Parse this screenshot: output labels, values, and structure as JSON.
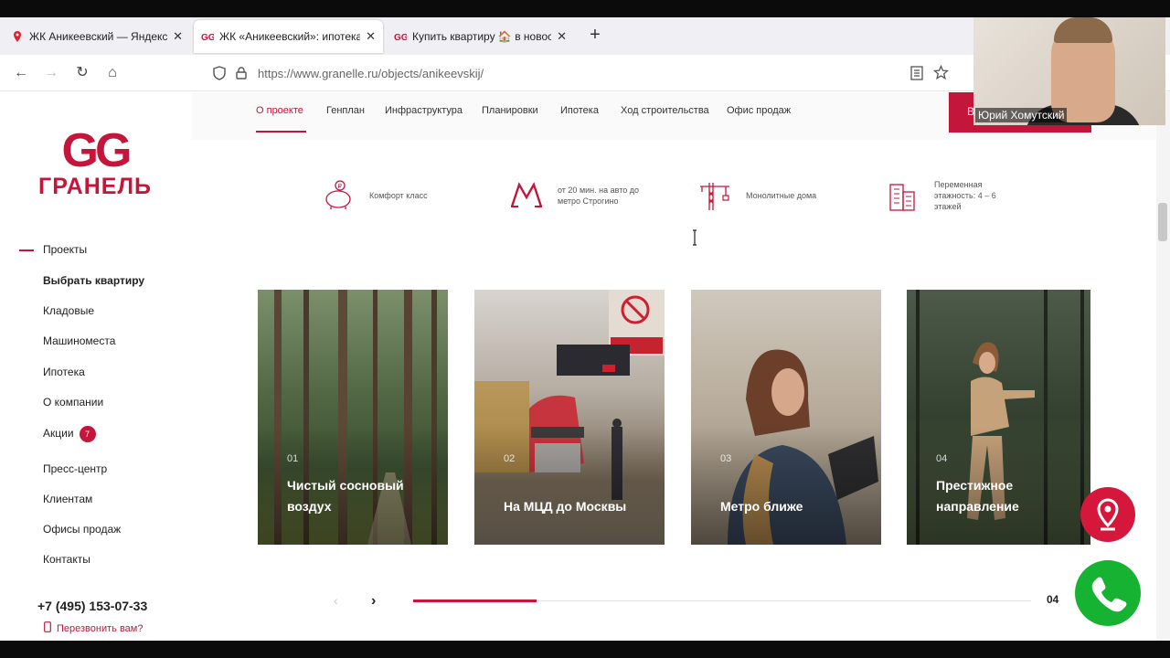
{
  "browser": {
    "tabs": [
      {
        "label": "ЖК Аникеевский — Яндекс.Карты",
        "active": false,
        "favicon": "map-pin-icon"
      },
      {
        "label": "ЖК «Аникеевский»: ипотека и",
        "active": true,
        "favicon": "granel-gg-icon"
      },
      {
        "label": "Купить квартиру 🏠 в новостройке",
        "active": false,
        "favicon": "granel-gg-icon"
      }
    ],
    "url": "https://www.granelle.ru/objects/anikeevskij/",
    "new_tab_label": "+"
  },
  "webcam": {
    "name": "Юрий Хомутский"
  },
  "subnav": {
    "items": [
      "О проекте",
      "Генплан",
      "Инфраструктура",
      "Планировки",
      "Ипотека",
      "Ход строительства",
      "Офис продаж"
    ],
    "active_index": 0,
    "cta_label": "В"
  },
  "logo": {
    "mark": "GG",
    "name": "ГРАНЕЛЬ"
  },
  "sidebar": {
    "items": [
      {
        "label": "Проекты",
        "bold": false,
        "active": true
      },
      {
        "label": "Выбрать квартиру",
        "bold": true
      },
      {
        "label": "Кладовые"
      },
      {
        "label": "Машиноместа"
      },
      {
        "label": "Ипотека"
      },
      {
        "label": "О компании"
      },
      {
        "label": "Акции",
        "badge": "7"
      },
      {
        "label": "Пресс-центр"
      },
      {
        "label": "Клиентам"
      },
      {
        "label": "Офисы продаж"
      },
      {
        "label": "Контакты"
      }
    ],
    "phone": "+7 (495) 153-07-33",
    "callback": "Перезвонить вам?"
  },
  "features": [
    {
      "icon": "piggy-bank-icon",
      "text": "Комфорт класс"
    },
    {
      "icon": "metro-icon",
      "text": "от 20 мин. на авто до метро Строгино"
    },
    {
      "icon": "crane-icon",
      "text": "Монолитные дома"
    },
    {
      "icon": "buildings-icon",
      "text": "Переменная этажность: 4 – 6 этажей"
    }
  ],
  "cards": [
    {
      "num": "01",
      "title": "Чистый сосновый воздух"
    },
    {
      "num": "02",
      "title": "На МЦД до Москвы"
    },
    {
      "num": "03",
      "title": "Метро ближе"
    },
    {
      "num": "04",
      "title": "Престижное направление"
    }
  ],
  "slider": {
    "counter": "04",
    "progress": 0.2
  },
  "colors": {
    "brand": "#c4153a",
    "call": "#16b232"
  }
}
